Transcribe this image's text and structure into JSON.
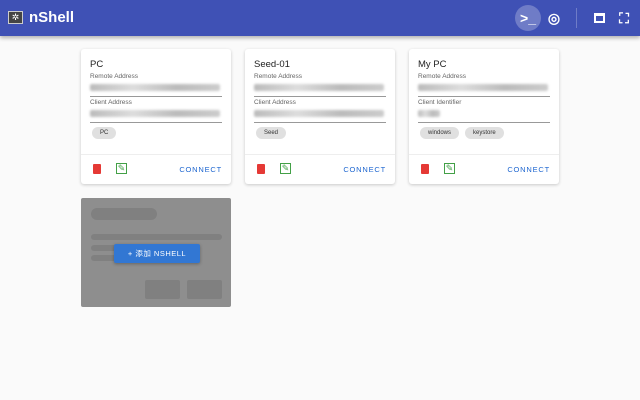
{
  "app": {
    "title": "nShell",
    "icons": [
      "terminal-icon",
      "fingerprint-icon",
      "window-icon",
      "fullscreen-icon"
    ]
  },
  "cards": [
    {
      "name": "PC",
      "field1": "Remote Address",
      "field2": "Client Address",
      "tags": [
        "PC"
      ],
      "connect": "CONNECT"
    },
    {
      "name": "Seed-01",
      "field1": "Remote Address",
      "field2": "Client Address",
      "tags": [
        "Seed"
      ],
      "connect": "CONNECT"
    },
    {
      "name": "My PC",
      "field1": "Remote Address",
      "field2": "Client Identifier",
      "tags": [
        "windows",
        "keystore"
      ],
      "connect": "CONNECT"
    }
  ],
  "add_button": "+ 添加 NSHELL",
  "colors": {
    "primary": "#3f51b5",
    "delete": "#e53935",
    "edit": "#43a047",
    "link": "#1e66d0"
  }
}
